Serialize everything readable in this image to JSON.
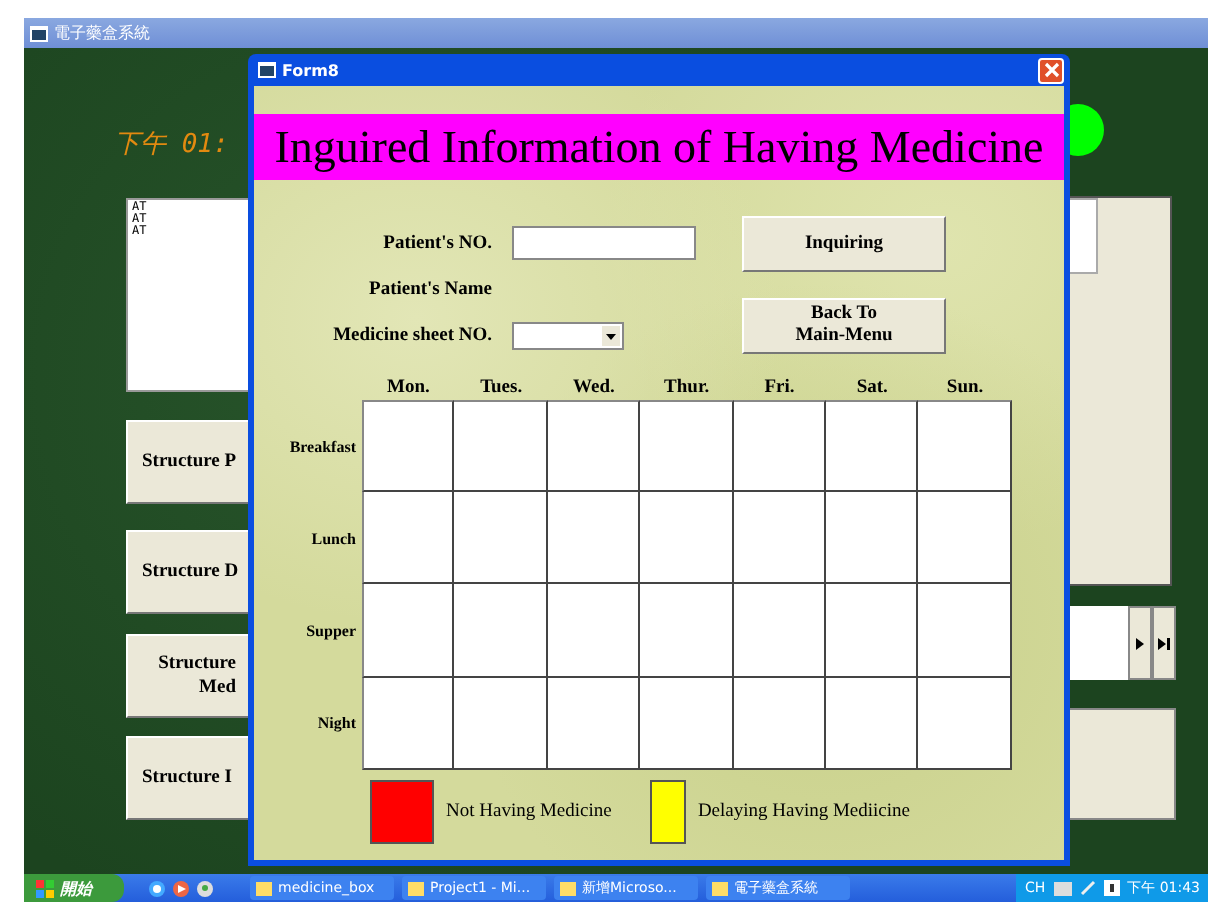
{
  "main_window": {
    "title": "電子藥盒系統",
    "clock": "下午 01:",
    "list_items": [
      "AT",
      "AT",
      "AT"
    ],
    "buttons": [
      {
        "label": "Structure P"
      },
      {
        "label": "Structure D"
      },
      {
        "label": "Structure\nMed"
      },
      {
        "label": "Structure I"
      }
    ]
  },
  "dialog": {
    "title": "Form8",
    "heading": "Inguired Information of Having Medicine",
    "fields": [
      {
        "label": "Patient's NO.",
        "kind": "text"
      },
      {
        "label": "Patient's Name",
        "kind": "none"
      },
      {
        "label": "Medicine sheet NO.",
        "kind": "combo"
      }
    ],
    "buttons": [
      {
        "label": "Inquiring"
      },
      {
        "label": "Back To\nMain-Menu"
      }
    ],
    "days": [
      "Mon.",
      "Tues.",
      "Wed.",
      "Thur.",
      "Fri.",
      "Sat.",
      "Sun."
    ],
    "meals": [
      "Breakfast",
      "Lunch",
      "Supper",
      "Night"
    ],
    "legend": [
      {
        "label": "Not Having Medicine",
        "color": "#ff0000"
      },
      {
        "label": "Delaying Having Mediicine",
        "color": "#ffff00"
      }
    ]
  },
  "taskbar": {
    "start": "開始",
    "tasks": [
      "medicine_box",
      "Project1 - Mi...",
      "新增Microso...",
      "電子藥盒系統"
    ],
    "language": "CH",
    "time": "下午 01:43"
  }
}
